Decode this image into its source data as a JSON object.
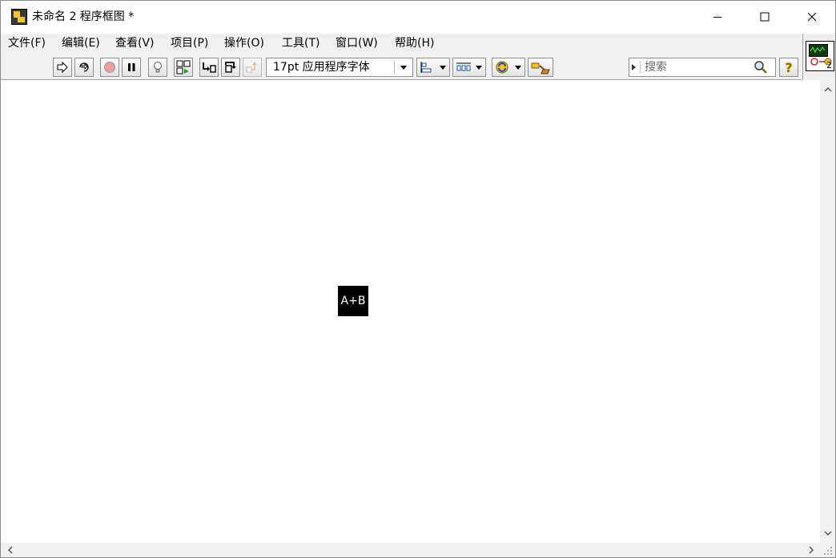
{
  "window": {
    "title": "未命名 2 程序框图 *"
  },
  "menu": [
    {
      "label": "文件(F)"
    },
    {
      "label": "编辑(E)"
    },
    {
      "label": "查看(V)"
    },
    {
      "label": "项目(P)"
    },
    {
      "label": "操作(O)"
    },
    {
      "label": "工具(T)"
    },
    {
      "label": "窗口(W)"
    },
    {
      "label": "帮助(H)"
    }
  ],
  "toolbar": {
    "font_select": "17pt 应用程序字体",
    "search_placeholder": "搜索",
    "help_label": "?"
  },
  "connector_pane": {
    "number": "2"
  },
  "diagram": {
    "node_label": "A+B"
  },
  "colors": {
    "chrome": "#f0f0f0",
    "canvas": "#ffffff",
    "node": "#000000"
  }
}
